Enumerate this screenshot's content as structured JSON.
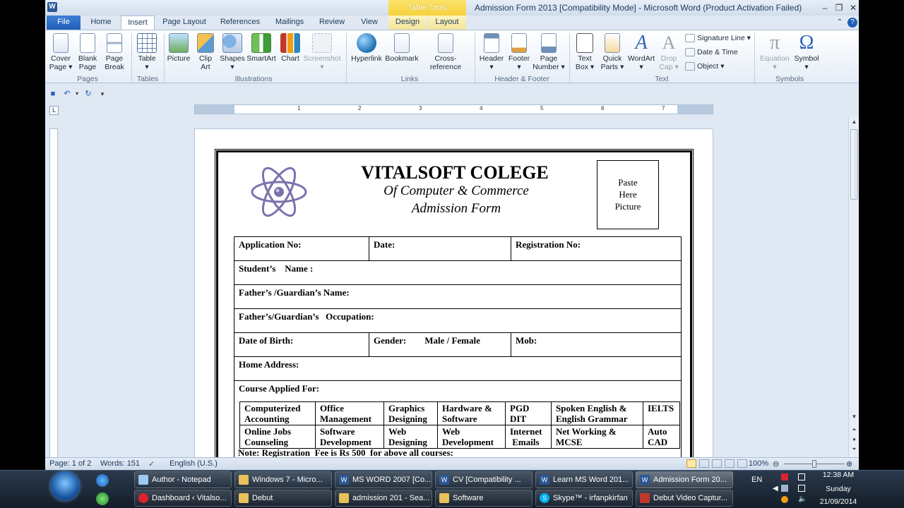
{
  "window": {
    "title": "Admission Form 2013 [Compatibility Mode] - Microsoft Word (Product Activation Failed)",
    "app_icon_label": "W",
    "contextual_tab_group": "Table Tools"
  },
  "tabs": [
    "File",
    "Home",
    "Insert",
    "Page Layout",
    "References",
    "Mailings",
    "Review",
    "View",
    "Design",
    "Layout"
  ],
  "ribbon": {
    "groups": {
      "pages": "Pages",
      "tables": "Tables",
      "illustrations": "Illustrations",
      "links": "Links",
      "header_footer": "Header & Footer",
      "text": "Text",
      "symbols": "Symbols"
    },
    "buttons": {
      "cover_page_1": "Cover",
      "cover_page_2": "Page ▾",
      "blank_page_1": "Blank",
      "blank_page_2": "Page",
      "page_break_1": "Page",
      "page_break_2": "Break",
      "table_1": "Table",
      "table_2": "▾",
      "picture": "Picture",
      "clip_art_1": "Clip",
      "clip_art_2": "Art",
      "shapes_1": "Shapes",
      "shapes_2": "▾",
      "smartart": "SmartArt",
      "chart": "Chart",
      "screenshot_1": "Screenshot",
      "screenshot_2": "▾",
      "hyperlink": "Hyperlink",
      "bookmark": "Bookmark",
      "cross_reference": "Cross-reference",
      "header_1": "Header",
      "header_2": "▾",
      "footer_1": "Footer",
      "footer_2": "▾",
      "page_number_1": "Page",
      "page_number_2": "Number ▾",
      "text_box_1": "Text",
      "text_box_2": "Box ▾",
      "quick_parts_1": "Quick",
      "quick_parts_2": "Parts ▾",
      "wordart_1": "WordArt",
      "wordart_2": "▾",
      "drop_cap_1": "Drop",
      "drop_cap_2": "Cap ▾",
      "signature_line": "Signature Line ▾",
      "date_time": "Date & Time",
      "object": "Object ▾",
      "equation_1": "Equation",
      "equation_2": "▾",
      "symbol_1": "Symbol",
      "symbol_2": "▾"
    },
    "glyphs": {
      "pi": "π",
      "omega": "Ω",
      "wordart": "A",
      "dropcap": "A"
    }
  },
  "ruler_numbers": [
    "1",
    "2",
    "3",
    "4",
    "5",
    "6",
    "7"
  ],
  "document": {
    "college_name": "VITALSOFT COLEGE",
    "subtitle": "Of Computer & Commerce",
    "form_title": "Admission Form",
    "photo_box": [
      "Paste",
      "Here",
      "Picture"
    ],
    "fields": {
      "application_no": "Application No:",
      "date": "Date:",
      "registration_no": "Registration No:",
      "student_name": "Student’s    Name :",
      "father_name": "Father’s /Guardian’s Name:",
      "father_occupation": "Father’s/Guardian’s   Occupation:",
      "dob": "Date of Birth:",
      "gender": "Gender:        Male / Female",
      "mob": "Mob:",
      "home_address": "Home Address:",
      "course_applied": "Course Applied For:"
    },
    "courses": [
      [
        [
          "Computerized",
          "Accounting"
        ],
        [
          "Office",
          "Management"
        ],
        [
          "Graphics",
          "Designing"
        ],
        [
          "Hardware &",
          "Software"
        ],
        [
          "PGD",
          "DIT"
        ],
        [
          "Spoken English  &",
          "English Grammar"
        ],
        [
          "IELTS",
          ""
        ]
      ],
      [
        [
          "Online Jobs",
          "Counseling"
        ],
        [
          "Software",
          "Development"
        ],
        [
          "Web",
          "Designing"
        ],
        [
          "Web",
          "Development"
        ],
        [
          "Internet",
          " Emails"
        ],
        [
          "Net Working  &",
          "MCSE"
        ],
        [
          "Auto",
          "CAD"
        ]
      ]
    ],
    "note": "Note: Registration  Fee is Rs 500  for above all courses:"
  },
  "status": {
    "page": "Page: 1 of 2",
    "words": "Words: 151",
    "language": "English (U.S.)",
    "zoom": "100%"
  },
  "taskbar": {
    "row1": [
      {
        "label": "Author - Notepad",
        "icon": "notepad-icon"
      },
      {
        "label": "Windows 7 - Micro...",
        "icon": "folder-icon"
      },
      {
        "label": "MS WORD 2007 [Co...",
        "icon": "word-icon"
      },
      {
        "label": "CV [Compatibility ...",
        "icon": "word-icon"
      },
      {
        "label": "Learn MS Word 201...",
        "icon": "word-icon"
      },
      {
        "label": "Admission Form 20...",
        "icon": "word-icon"
      }
    ],
    "row2": [
      {
        "label": "Dashboard ‹ Vitalso...",
        "icon": "opera-icon"
      },
      {
        "label": "Debut",
        "icon": "folder-icon"
      },
      {
        "label": "admission 201 - Sea...",
        "icon": "folder-icon"
      },
      {
        "label": "Software",
        "icon": "folder-icon"
      },
      {
        "label": "Skype™ - irfanpkirfan",
        "icon": "skype-icon"
      },
      {
        "label": "Debut Video Captur...",
        "icon": "debut-icon"
      }
    ],
    "tray": {
      "lang": "EN",
      "time": "12:38 AM",
      "day": "Sunday",
      "date": "21/09/2014"
    }
  },
  "colors": {
    "accent": "#1f5eb7",
    "context_tab": "#f5d23c",
    "atom": "#7b72ad"
  }
}
